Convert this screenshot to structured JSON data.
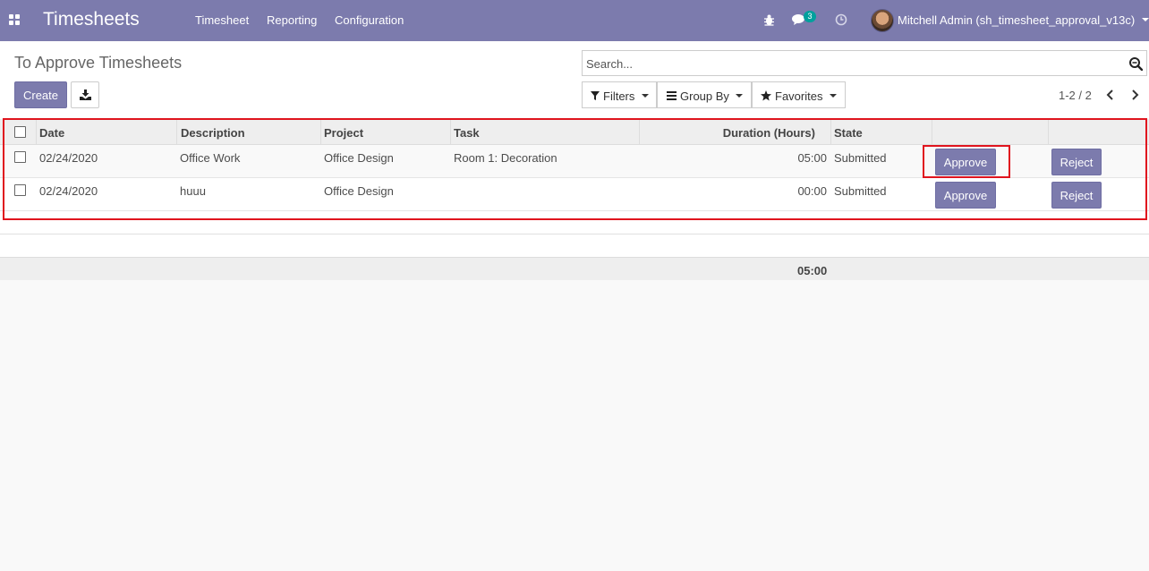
{
  "navbar": {
    "app_title": "Timesheets",
    "menu": [
      "Timesheet",
      "Reporting",
      "Configuration"
    ],
    "messages_count": "3",
    "user": "Mitchell Admin (sh_timesheet_approval_v13c)"
  },
  "control_panel": {
    "title": "To Approve Timesheets",
    "search_placeholder": "Search...",
    "create_label": "Create",
    "filters_label": "Filters",
    "group_by_label": "Group By",
    "favorites_label": "Favorites",
    "pager": "1-2 / 2"
  },
  "table": {
    "columns": [
      "Date",
      "Description",
      "Project",
      "Task",
      "Duration (Hours)",
      "State"
    ],
    "rows": [
      {
        "date": "02/24/2020",
        "description": "Office Work",
        "project": "Office Design",
        "task": "Room 1: Decoration",
        "duration": "05:00",
        "state": "Submitted",
        "approve": "Approve",
        "reject": "Reject"
      },
      {
        "date": "02/24/2020",
        "description": "huuu",
        "project": "Office Design",
        "task": "",
        "duration": "00:00",
        "state": "Submitted",
        "approve": "Approve",
        "reject": "Reject"
      }
    ],
    "total_duration": "05:00"
  },
  "colors": {
    "brand": "#7c7bad",
    "badge": "#00a09d",
    "highlight": "#e0141e"
  }
}
